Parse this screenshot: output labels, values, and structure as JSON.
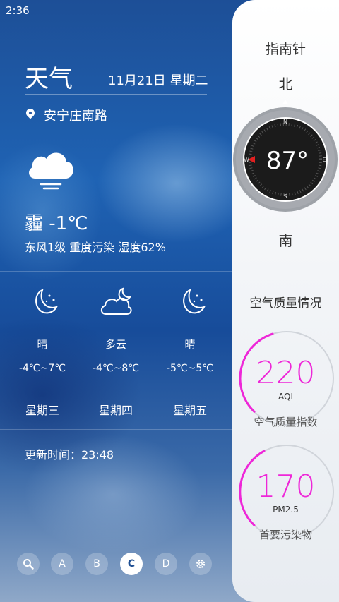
{
  "status": {
    "time": "2:36",
    "signal": "•••",
    "sim": "✕"
  },
  "weather": {
    "title": "天气",
    "date": "11月21日  星期二",
    "location": "安宁庄南路",
    "condition": "霾  -1℃",
    "details": "东风1级  重度污染  湿度62%",
    "forecast": [
      {
        "icon": "moon-stars-icon",
        "text": "晴",
        "temp": "-4℃~7℃",
        "day": "星期三"
      },
      {
        "icon": "cloud-moon-icon",
        "text": "多云",
        "temp": "-4℃~8℃",
        "day": "星期四"
      },
      {
        "icon": "moon-stars-icon",
        "text": "晴",
        "temp": "-5℃~5℃",
        "day": "星期五"
      }
    ],
    "updated": "更新时间：23:48"
  },
  "nav": {
    "items": [
      {
        "label": "",
        "icon": "search-icon"
      },
      {
        "label": "A"
      },
      {
        "label": "B"
      },
      {
        "label": "C",
        "active": true
      },
      {
        "label": "D"
      },
      {
        "label": "",
        "icon": "gear-icon"
      }
    ]
  },
  "compass": {
    "title": "指南针",
    "north_label": "北",
    "south_label": "南",
    "heading": "87°",
    "dial": {
      "n": "N",
      "s": "S",
      "e": "E",
      "w": "W"
    }
  },
  "air": {
    "title": "空气质量情况",
    "aqi_value": "220",
    "aqi_unit": "AQI",
    "aqi_caption": "空气质量指数",
    "pm_value": "170",
    "pm_unit": "PM2.5",
    "pm_caption": "首要污染物",
    "accent_color": "#ee27d8"
  }
}
